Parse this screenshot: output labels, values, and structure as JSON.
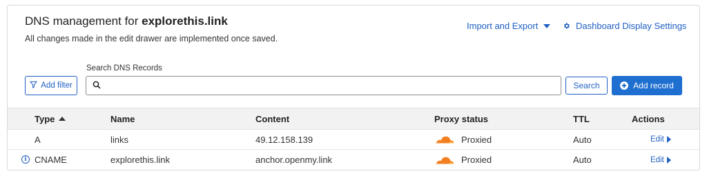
{
  "header": {
    "title_prefix": "DNS management for",
    "domain": "explorethis.link",
    "subtitle": "All changes made in the edit drawer are implemented once saved.",
    "import_export_label": "Import and Export",
    "dashboard_settings_label": "Dashboard Display Settings"
  },
  "toolbar": {
    "search_label": "Search DNS Records",
    "search_value": "",
    "add_filter_label": "Add filter",
    "search_button_label": "Search",
    "add_record_label": "Add record"
  },
  "table": {
    "columns": {
      "type": "Type",
      "name": "Name",
      "content": "Content",
      "proxy_status": "Proxy status",
      "ttl": "TTL",
      "actions": "Actions"
    },
    "sorted_column": "Type",
    "sort_direction": "ascending",
    "rows": [
      {
        "type": "A",
        "name": "links",
        "content": "49.12.158.139",
        "proxy_status": "Proxied",
        "ttl": "Auto",
        "action": "Edit",
        "info_icon": false
      },
      {
        "type": "CNAME",
        "name": "explorethis.link",
        "content": "anchor.openmy.link",
        "proxy_status": "Proxied",
        "ttl": "Auto",
        "action": "Edit",
        "info_icon": true
      }
    ]
  },
  "icons": {
    "proxy": "orange-cloud-icon",
    "filter": "filter-icon",
    "search": "search-icon",
    "settings": "gear-icon",
    "add": "plus-circle-icon",
    "info": "info-icon"
  },
  "colors": {
    "accent": "#1f5fc2",
    "primary_button": "#1f6fd0",
    "proxied_cloud": "#f38020",
    "header_background": "#f2f2f2"
  }
}
